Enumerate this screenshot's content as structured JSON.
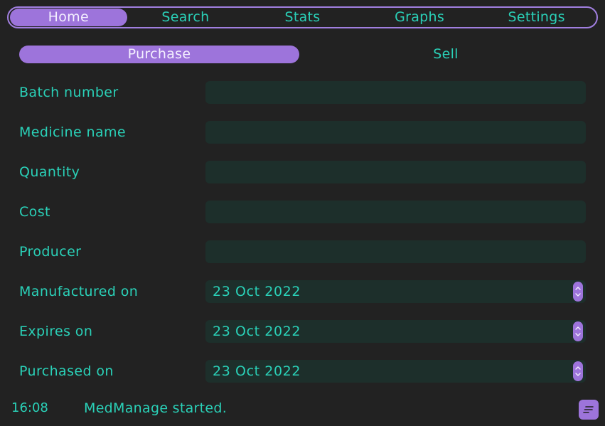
{
  "nav": {
    "tabs": [
      {
        "label": "Home",
        "active": true
      },
      {
        "label": "Search",
        "active": false
      },
      {
        "label": "Stats",
        "active": false
      },
      {
        "label": "Graphs",
        "active": false
      },
      {
        "label": "Settings",
        "active": false
      }
    ]
  },
  "subtabs": [
    {
      "label": "Purchase",
      "active": true
    },
    {
      "label": "Sell",
      "active": false
    }
  ],
  "form": {
    "batch_number": {
      "label": "Batch number",
      "value": ""
    },
    "medicine_name": {
      "label": "Medicine name",
      "value": ""
    },
    "quantity": {
      "label": "Quantity",
      "value": ""
    },
    "cost": {
      "label": "Cost",
      "value": ""
    },
    "producer": {
      "label": "Producer",
      "value": ""
    },
    "manufactured_on": {
      "label": "Manufactured on",
      "value": "23 Oct 2022"
    },
    "expires_on": {
      "label": "Expires on",
      "value": "23 Oct 2022"
    },
    "purchased_on": {
      "label": "Purchased on",
      "value": "23 Oct 2022"
    }
  },
  "status": {
    "time": "16:08",
    "message": "MedManage started."
  },
  "colors": {
    "background": "#222222",
    "accent": "#9d74db",
    "text": "#2ad1b8",
    "field_background": "#1d2f2b"
  },
  "icons": {
    "spinner": "chevron-up-down-icon",
    "log": "log-lines-icon"
  }
}
